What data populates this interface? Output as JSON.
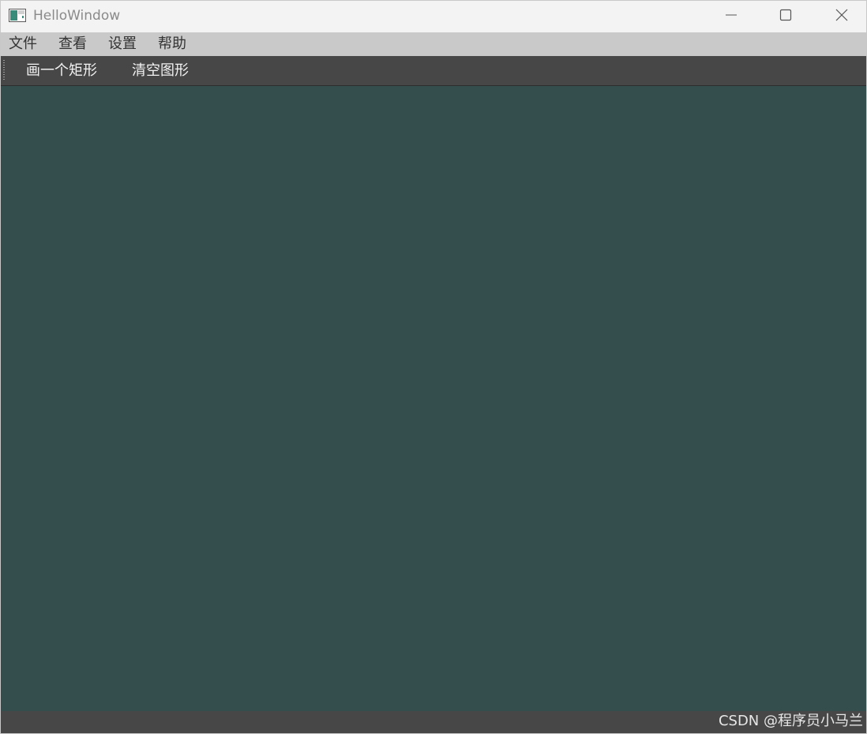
{
  "window": {
    "title": "HelloWindow",
    "icons": {
      "app": "app-window-icon",
      "minimize": "minimize-icon",
      "maximize": "maximize-icon",
      "close": "close-icon"
    }
  },
  "menubar": {
    "items": [
      {
        "label": "文件"
      },
      {
        "label": "查看"
      },
      {
        "label": "设置"
      },
      {
        "label": "帮助"
      }
    ]
  },
  "toolbar": {
    "buttons": [
      {
        "label": "画一个矩形"
      },
      {
        "label": "清空图形"
      }
    ]
  },
  "statusbar": {
    "watermark": "CSDN @程序员小马兰"
  },
  "colors": {
    "titlebar": "#f3f3f3",
    "menubar": "#c9c9c9",
    "toolbar": "#474747",
    "canvas": "#344d4d",
    "statusbar": "#474747"
  }
}
